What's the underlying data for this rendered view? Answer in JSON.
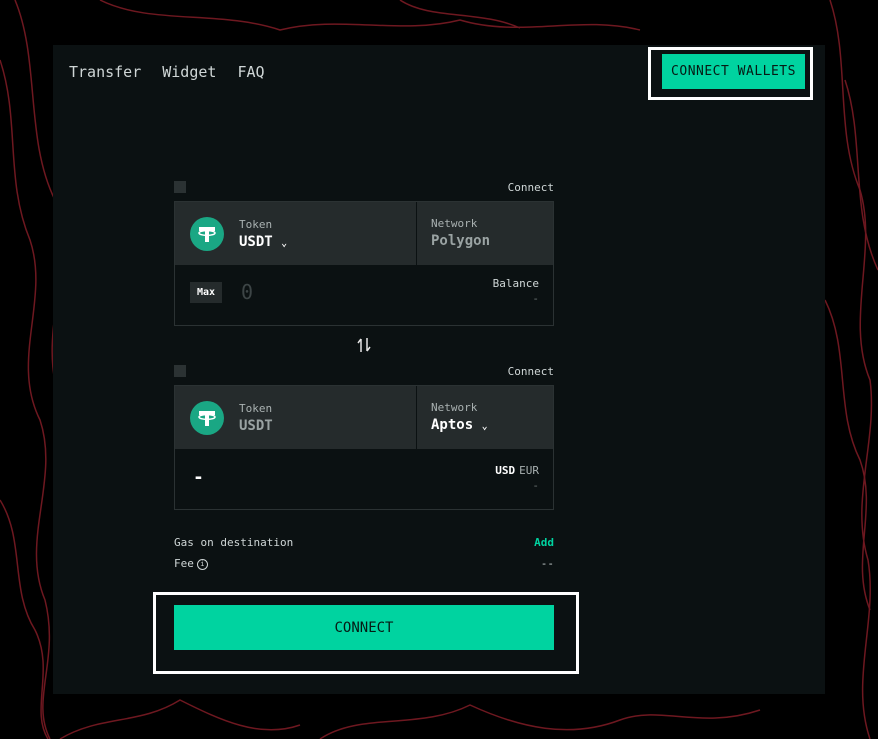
{
  "nav": {
    "items": [
      "Transfer",
      "Widget",
      "FAQ"
    ]
  },
  "header": {
    "connect_wallets_label": "CONNECT WALLETS"
  },
  "source": {
    "connect_label": "Connect",
    "token_label": "Token",
    "token_value": "USDT",
    "network_label": "Network",
    "network_value": "Polygon",
    "max_label": "Max",
    "amount_placeholder": "0",
    "balance_label": "Balance",
    "balance_value": "-"
  },
  "destination": {
    "connect_label": "Connect",
    "token_label": "Token",
    "token_value": "USDT",
    "network_label": "Network",
    "network_value": "Aptos",
    "amount_value": "-",
    "currency_usd": "USD",
    "currency_eur": "EUR",
    "fiat_value": "-"
  },
  "info": {
    "gas_label": "Gas on destination",
    "gas_action": "Add",
    "fee_label": "Fee",
    "fee_value": "--"
  },
  "main_button_label": "CONNECT",
  "colors": {
    "accent": "#00d3a0",
    "panel": "#0b1112",
    "card": "#252b2c",
    "lines": "#7a1a22"
  }
}
